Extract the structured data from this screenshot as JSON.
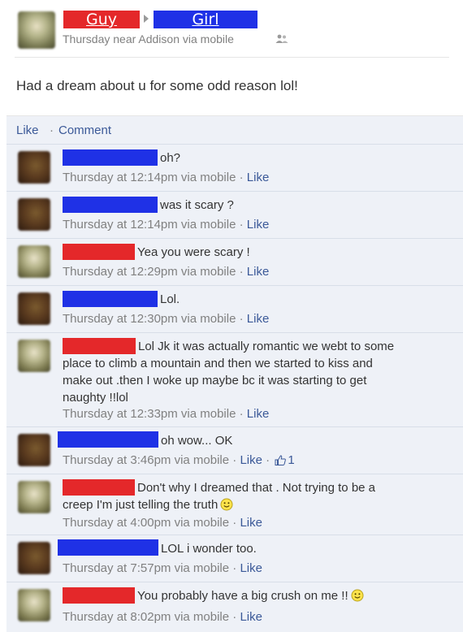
{
  "post": {
    "author_label": "Guy",
    "recipient_label": "Girl",
    "meta": "Thursday near Addison via mobile",
    "text": "Had a dream about u for some odd reason lol!"
  },
  "actions": {
    "like": "Like",
    "separator": "·",
    "comment": "Comment"
  },
  "comments": [
    {
      "text": "oh?",
      "time": "Thursday at 12:14pm via mobile · ",
      "like": "Like"
    },
    {
      "text": "was it scary ?",
      "time": "Thursday at 12:14pm via mobile · ",
      "like": "Like"
    },
    {
      "text": "Yea you were scary !",
      "time": "Thursday at 12:29pm via mobile · ",
      "like": "Like"
    },
    {
      "text": "Lol.",
      "time": "Thursday at 12:30pm via mobile · ",
      "like": "Like"
    },
    {
      "text_line1": "Lol Jk it was actually romantic we webt to some",
      "text_line2": "place to climb a mountain and then we started to kiss and",
      "text_line3": "make out .then I woke up maybe bc it was starting to get",
      "text_line4": "naughty !!lol",
      "time": "Thursday at 12:33pm via mobile · ",
      "like": "Like"
    },
    {
      "text": "oh wow... OK",
      "time": "Thursday at 3:46pm via mobile · ",
      "like": "Like",
      "like_sep": " · ",
      "like_count": "1"
    },
    {
      "text_line1": "Don't why I dreamed that . Not trying to be a",
      "text_line2": "creep I'm just telling the truth",
      "time": "Thursday at 4:00pm via mobile · ",
      "like": "Like"
    },
    {
      "text": "LOL i wonder too.",
      "time": "Thursday at 7:57pm via mobile · ",
      "like": "Like"
    },
    {
      "text": "You probably have a big crush on me !!",
      "time": "Thursday at 8:02pm via mobile · ",
      "like": "Like"
    }
  ],
  "colors": {
    "guy_name_bar": "#e4282a",
    "girl_name_bar": "#1f31e6",
    "link": "#3b5998",
    "comment_bg": "#eef1f7"
  },
  "icons": {
    "friends": "friends-icon",
    "like_thumb": "thumbs-up-icon",
    "smiley": "smiley-icon"
  }
}
